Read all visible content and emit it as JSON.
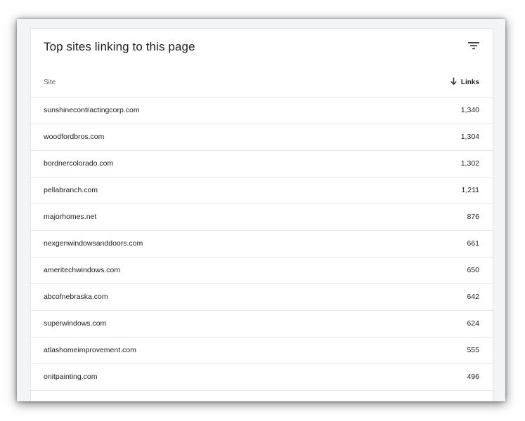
{
  "card": {
    "title": "Top sites linking to this page",
    "filter_icon": "filter-list-icon"
  },
  "table": {
    "headers": {
      "site": "Site",
      "links": "Links",
      "sort_icon": "arrow-down-icon"
    },
    "rows": [
      {
        "site": "sunshinecontractingcorp.com",
        "links": "1,340"
      },
      {
        "site": "woodfordbros.com",
        "links": "1,304"
      },
      {
        "site": "bordnercolorado.com",
        "links": "1,302"
      },
      {
        "site": "pellabranch.com",
        "links": "1,211"
      },
      {
        "site": "majorhomes.net",
        "links": "876"
      },
      {
        "site": "nexgenwindowsanddoors.com",
        "links": "661"
      },
      {
        "site": "ameritechwindows.com",
        "links": "650"
      },
      {
        "site": "abcofnebraska.com",
        "links": "642"
      },
      {
        "site": "superwindows.com",
        "links": "624"
      },
      {
        "site": "atlashomeimprovement.com",
        "links": "555"
      },
      {
        "site": "onitpainting.com",
        "links": "496"
      },
      {
        "site": "",
        "links": ""
      }
    ]
  },
  "colors": {
    "text": "#202124",
    "muted": "#5f6368",
    "divider": "#e6e6e6",
    "frame_bg": "#f3f4f6"
  }
}
